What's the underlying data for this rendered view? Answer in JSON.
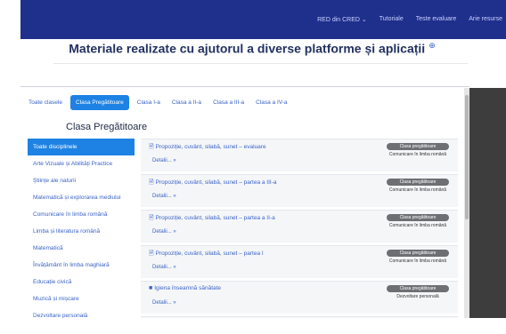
{
  "topnav": {
    "links": [
      "RED din CRED ⌄",
      "Tutoriale",
      "Teste evaluare",
      "Arie resurse"
    ]
  },
  "page": {
    "title": "Materiale realizate cu ajutorul a diverse platforme și aplicații",
    "title_link_glyph": "⊕"
  },
  "tabs": [
    {
      "label": "Toate clasele",
      "active": false
    },
    {
      "label": "Clasa Pregătitoare",
      "active": true
    },
    {
      "label": "Clasa I-a",
      "active": false
    },
    {
      "label": "Clasa a II-a",
      "active": false
    },
    {
      "label": "Clasa a III-a",
      "active": false
    },
    {
      "label": "Clasa a IV-a",
      "active": false
    }
  ],
  "section": {
    "heading": "Clasa Pregătitoare"
  },
  "sidebar": {
    "items": [
      {
        "label": "Toate disciplinele",
        "active": true
      },
      {
        "label": "Arte Vizuale și Abilități Practice",
        "active": false
      },
      {
        "label": "Științe ale naturii",
        "active": false
      },
      {
        "label": "Matematică și explorarea mediului",
        "active": false
      },
      {
        "label": "Comunicare în limba română",
        "active": false
      },
      {
        "label": "Limba și literatura română",
        "active": false
      },
      {
        "label": "Matematică",
        "active": false
      },
      {
        "label": "Învățământ în limba maghiară",
        "active": false
      },
      {
        "label": "Educație civică",
        "active": false
      },
      {
        "label": "Muzică și mișcare",
        "active": false
      },
      {
        "label": "Dezvoltare personală",
        "active": false
      }
    ]
  },
  "materials": [
    {
      "icon": "document-icon",
      "glyph": "🗎",
      "title": "Propoziție, cuvânt, silabă, sunet – evaluare",
      "detail": "Detalii... »",
      "badge": "Clasa pregătitoare",
      "subject": "Comunicare în limba română"
    },
    {
      "icon": "document-icon",
      "glyph": "🗎",
      "title": "Propoziție, cuvânt, silabă, sunet – partea a III-a",
      "detail": "Detalii... »",
      "badge": "Clasa pregătitoare",
      "subject": "Comunicare în limba română"
    },
    {
      "icon": "document-icon",
      "glyph": "🗎",
      "title": "Propoziție, cuvânt, silabă, sunet – partea a II-a",
      "detail": "Detalii... »",
      "badge": "Clasa pregătitoare",
      "subject": "Comunicare în limba română"
    },
    {
      "icon": "document-icon",
      "glyph": "🗎",
      "title": "Propoziție, cuvânt, silabă, sunet – partea I",
      "detail": "Detalii... »",
      "badge": "Clasa pregătitoare",
      "subject": "Comunicare în limba română"
    },
    {
      "icon": "video-icon",
      "glyph": "■",
      "title": "Igiena înseamnă sănătate",
      "detail": "Detalii... »",
      "badge": "Clasa pregătitoare",
      "subject": "Dezvoltare personală"
    }
  ],
  "colors": {
    "nav_bg": "#1f2f8c",
    "accent": "#1d82e3",
    "link": "#3b63c7",
    "badge": "#6e6f73"
  }
}
